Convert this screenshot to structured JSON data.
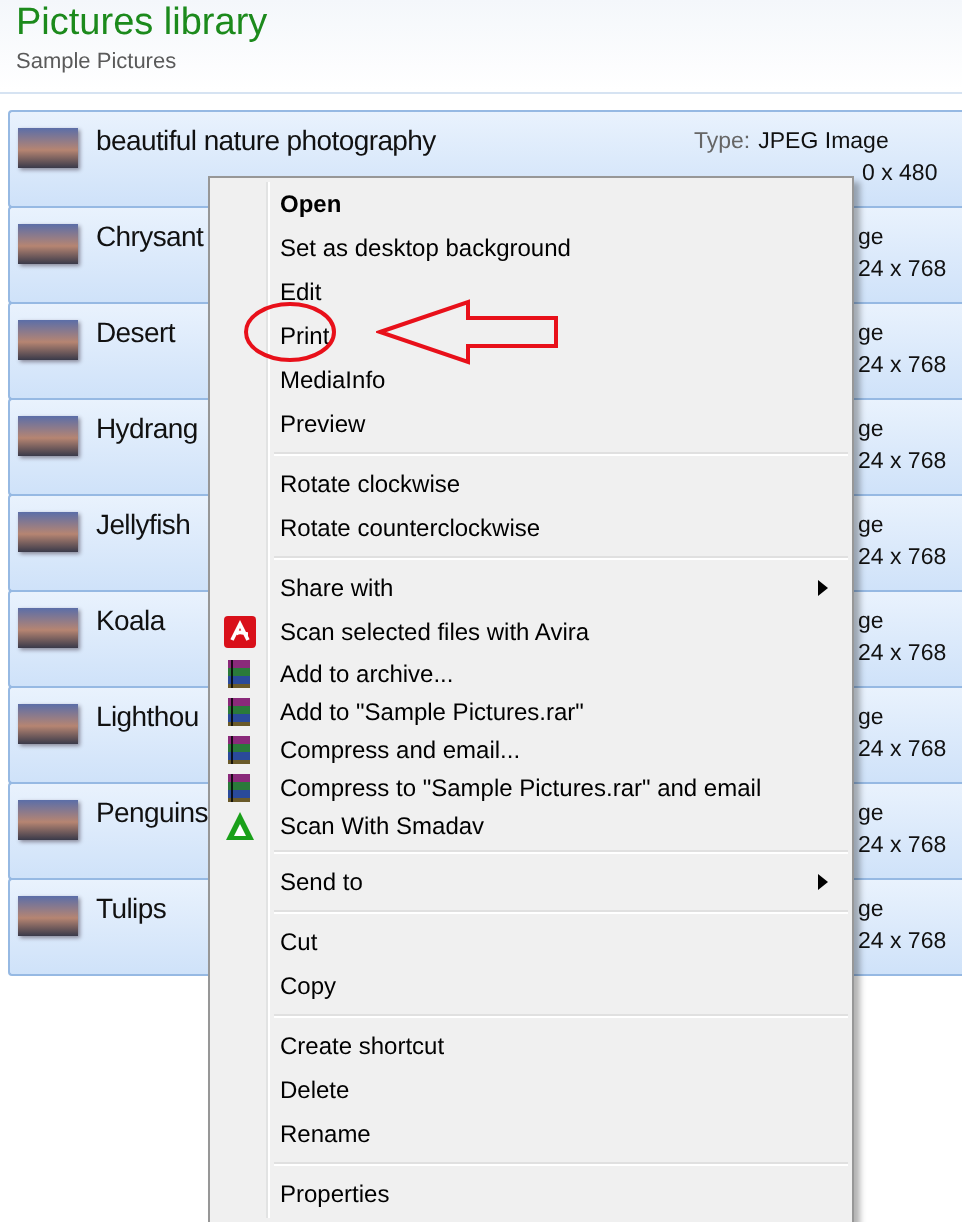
{
  "header": {
    "title": "Pictures library",
    "subtitle": "Sample Pictures"
  },
  "files": [
    {
      "name": "beautiful nature photography",
      "selected": true,
      "kind": "full",
      "details": [
        {
          "label": "Type:",
          "value": "JPEG Image"
        },
        {
          "value": "0 x 480"
        }
      ]
    },
    {
      "name": "Chrysant",
      "selected": true,
      "kind": "cut",
      "details": [
        {
          "value": "ge"
        },
        {
          "value": "24 x 768"
        }
      ]
    },
    {
      "name": "Desert",
      "selected": true,
      "kind": "cut",
      "details": [
        {
          "value": "ge"
        },
        {
          "value": "24 x 768"
        }
      ]
    },
    {
      "name": "Hydrang",
      "selected": true,
      "kind": "cut",
      "details": [
        {
          "value": "ge"
        },
        {
          "value": "24 x 768"
        }
      ]
    },
    {
      "name": "Jellyfish",
      "selected": true,
      "kind": "cut",
      "details": [
        {
          "value": "ge"
        },
        {
          "value": "24 x 768"
        }
      ]
    },
    {
      "name": "Koala",
      "selected": true,
      "kind": "cut",
      "details": [
        {
          "value": "ge"
        },
        {
          "value": "24 x 768"
        }
      ]
    },
    {
      "name": "Lighthou",
      "selected": true,
      "kind": "cut",
      "details": [
        {
          "value": "ge"
        },
        {
          "value": "24 x 768"
        }
      ]
    },
    {
      "name": "Penguins",
      "selected": true,
      "kind": "cut",
      "details": [
        {
          "value": "ge"
        },
        {
          "value": "24 x 768"
        }
      ]
    },
    {
      "name": "Tulips",
      "selected": true,
      "kind": "cut",
      "details": [
        {
          "value": "ge"
        },
        {
          "value": "24 x 768"
        }
      ]
    }
  ],
  "context_menu": [
    {
      "kind": "item",
      "label": "Open",
      "default": true
    },
    {
      "kind": "item",
      "label": "Set as desktop background"
    },
    {
      "kind": "item",
      "label": "Edit"
    },
    {
      "kind": "item",
      "label": "Print",
      "annotated": true
    },
    {
      "kind": "item",
      "label": "MediaInfo"
    },
    {
      "kind": "item",
      "label": "Preview"
    },
    {
      "kind": "separator"
    },
    {
      "kind": "item",
      "label": "Rotate clockwise"
    },
    {
      "kind": "item",
      "label": "Rotate counterclockwise"
    },
    {
      "kind": "separator"
    },
    {
      "kind": "item",
      "label": "Share with",
      "submenu": true
    },
    {
      "kind": "avira",
      "label": "Scan selected files with Avira"
    },
    {
      "kind": "archive",
      "label": "Add to archive..."
    },
    {
      "kind": "archive",
      "label": "Add to \"Sample Pictures.rar\""
    },
    {
      "kind": "archive",
      "label": "Compress and email..."
    },
    {
      "kind": "archive",
      "label": "Compress to \"Sample Pictures.rar\" and email"
    },
    {
      "kind": "smadav",
      "label": "Scan With Smadav"
    },
    {
      "kind": "separator"
    },
    {
      "kind": "item",
      "label": "Send to",
      "submenu": true
    },
    {
      "kind": "separator"
    },
    {
      "kind": "item",
      "label": "Cut"
    },
    {
      "kind": "item",
      "label": "Copy"
    },
    {
      "kind": "separator"
    },
    {
      "kind": "item",
      "label": "Create shortcut"
    },
    {
      "kind": "item",
      "label": "Delete"
    },
    {
      "kind": "item",
      "label": "Rename"
    },
    {
      "kind": "separator"
    },
    {
      "kind": "item",
      "label": "Properties"
    }
  ]
}
